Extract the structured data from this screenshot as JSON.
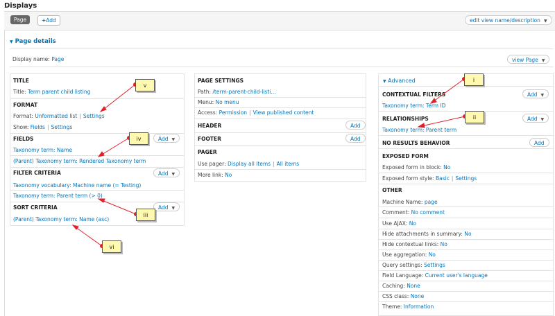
{
  "header": {
    "title": "Displays"
  },
  "tabs": {
    "page_tab": "Page",
    "add_label": "Add"
  },
  "edit_view_label": "edit view name/description",
  "page_details": {
    "heading": "Page details",
    "display_name_label": "Display name:",
    "display_name_value": "Page",
    "view_page_label": "view Page"
  },
  "left": {
    "title_header": "TITLE",
    "title_label": "Title:",
    "title_value": "Term parent child listing",
    "format_header": "FORMAT",
    "format_label": "Format:",
    "format_value": "Unformatted list",
    "format_settings": "Settings",
    "show_label": "Show:",
    "show_value": "Fields",
    "show_settings": "Settings",
    "fields_header": "FIELDS",
    "fields": [
      "Taxonomy term: Name",
      "(Parent) Taxonomy term: Rendered Taxonomy term"
    ],
    "filter_header": "FILTER CRITERIA",
    "filters": [
      "Taxonomy vocabulary: Machine name (= Testing)",
      "Taxonomy term: Parent term (> 0)"
    ],
    "sort_header": "SORT CRITERIA",
    "sorts": [
      "(Parent) Taxonomy term: Name (asc)"
    ],
    "add_label": "Add"
  },
  "middle": {
    "page_settings_header": "PAGE SETTINGS",
    "path_label": "Path:",
    "path_value": "/term-parent-child-listi...",
    "menu_label": "Menu:",
    "menu_value": "No menu",
    "access_label": "Access:",
    "access_value": "Permission",
    "access_extra": "View published content",
    "header_header": "HEADER",
    "footer_header": "FOOTER",
    "pager_header": "PAGER",
    "use_pager_label": "Use pager:",
    "use_pager_value": "Display all items",
    "use_pager_extra": "All items",
    "more_link_label": "More link:",
    "more_link_value": "No",
    "add_label": "Add"
  },
  "right": {
    "advanced_label": "Advanced",
    "contextual_header": "CONTEXTUAL FILTERS",
    "contextual_item": "Taxonomy term: Term ID",
    "relationships_header": "RELATIONSHIPS",
    "relationship_item": "Taxonomy term: Parent term",
    "no_results_header": "NO RESULTS BEHAVIOR",
    "exposed_header": "EXPOSED FORM",
    "exposed_block_label": "Exposed form in block:",
    "exposed_block_value": "No",
    "exposed_style_label": "Exposed form style:",
    "exposed_style_value": "Basic",
    "exposed_style_settings": "Settings",
    "other_header": "OTHER",
    "other_rows": [
      {
        "label": "Machine Name:",
        "value": "page"
      },
      {
        "label": "Comment:",
        "value": "No comment"
      },
      {
        "label": "Use AJAX:",
        "value": "No"
      },
      {
        "label": "Hide attachments in summary:",
        "value": "No"
      },
      {
        "label": "Hide contextual links:",
        "value": "No"
      },
      {
        "label": "Use aggregation:",
        "value": "No"
      },
      {
        "label": "Query settings:",
        "value": "Settings"
      },
      {
        "label": "Field Language:",
        "value": "Current user's language"
      },
      {
        "label": "Caching:",
        "value": "None"
      },
      {
        "label": "CSS class:",
        "value": "None"
      },
      {
        "label": "Theme:",
        "value": "Information"
      }
    ],
    "add_label": "Add"
  },
  "callouts": [
    "i",
    "ii",
    "iii",
    "iv",
    "v",
    "vi"
  ]
}
